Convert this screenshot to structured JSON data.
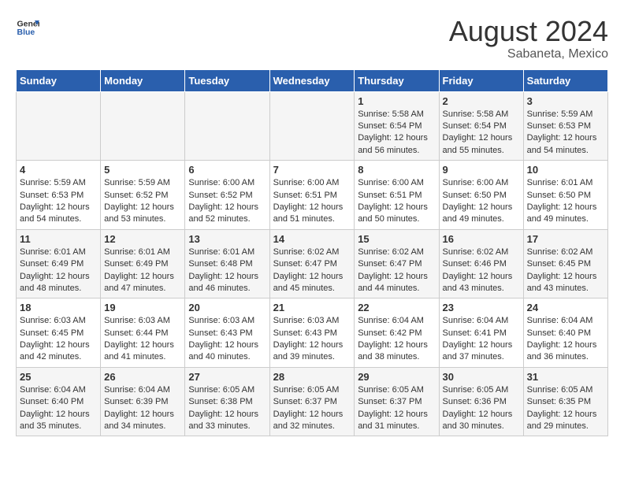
{
  "header": {
    "logo_general": "General",
    "logo_blue": "Blue",
    "title": "August 2024",
    "subtitle": "Sabaneta, Mexico"
  },
  "calendar": {
    "days_of_week": [
      "Sunday",
      "Monday",
      "Tuesday",
      "Wednesday",
      "Thursday",
      "Friday",
      "Saturday"
    ],
    "weeks": [
      [
        {
          "day": "",
          "detail": ""
        },
        {
          "day": "",
          "detail": ""
        },
        {
          "day": "",
          "detail": ""
        },
        {
          "day": "",
          "detail": ""
        },
        {
          "day": "1",
          "detail": "Sunrise: 5:58 AM\nSunset: 6:54 PM\nDaylight: 12 hours and 56 minutes."
        },
        {
          "day": "2",
          "detail": "Sunrise: 5:58 AM\nSunset: 6:54 PM\nDaylight: 12 hours and 55 minutes."
        },
        {
          "day": "3",
          "detail": "Sunrise: 5:59 AM\nSunset: 6:53 PM\nDaylight: 12 hours and 54 minutes."
        }
      ],
      [
        {
          "day": "4",
          "detail": "Sunrise: 5:59 AM\nSunset: 6:53 PM\nDaylight: 12 hours and 54 minutes."
        },
        {
          "day": "5",
          "detail": "Sunrise: 5:59 AM\nSunset: 6:52 PM\nDaylight: 12 hours and 53 minutes."
        },
        {
          "day": "6",
          "detail": "Sunrise: 6:00 AM\nSunset: 6:52 PM\nDaylight: 12 hours and 52 minutes."
        },
        {
          "day": "7",
          "detail": "Sunrise: 6:00 AM\nSunset: 6:51 PM\nDaylight: 12 hours and 51 minutes."
        },
        {
          "day": "8",
          "detail": "Sunrise: 6:00 AM\nSunset: 6:51 PM\nDaylight: 12 hours and 50 minutes."
        },
        {
          "day": "9",
          "detail": "Sunrise: 6:00 AM\nSunset: 6:50 PM\nDaylight: 12 hours and 49 minutes."
        },
        {
          "day": "10",
          "detail": "Sunrise: 6:01 AM\nSunset: 6:50 PM\nDaylight: 12 hours and 49 minutes."
        }
      ],
      [
        {
          "day": "11",
          "detail": "Sunrise: 6:01 AM\nSunset: 6:49 PM\nDaylight: 12 hours and 48 minutes."
        },
        {
          "day": "12",
          "detail": "Sunrise: 6:01 AM\nSunset: 6:49 PM\nDaylight: 12 hours and 47 minutes."
        },
        {
          "day": "13",
          "detail": "Sunrise: 6:01 AM\nSunset: 6:48 PM\nDaylight: 12 hours and 46 minutes."
        },
        {
          "day": "14",
          "detail": "Sunrise: 6:02 AM\nSunset: 6:47 PM\nDaylight: 12 hours and 45 minutes."
        },
        {
          "day": "15",
          "detail": "Sunrise: 6:02 AM\nSunset: 6:47 PM\nDaylight: 12 hours and 44 minutes."
        },
        {
          "day": "16",
          "detail": "Sunrise: 6:02 AM\nSunset: 6:46 PM\nDaylight: 12 hours and 43 minutes."
        },
        {
          "day": "17",
          "detail": "Sunrise: 6:02 AM\nSunset: 6:45 PM\nDaylight: 12 hours and 43 minutes."
        }
      ],
      [
        {
          "day": "18",
          "detail": "Sunrise: 6:03 AM\nSunset: 6:45 PM\nDaylight: 12 hours and 42 minutes."
        },
        {
          "day": "19",
          "detail": "Sunrise: 6:03 AM\nSunset: 6:44 PM\nDaylight: 12 hours and 41 minutes."
        },
        {
          "day": "20",
          "detail": "Sunrise: 6:03 AM\nSunset: 6:43 PM\nDaylight: 12 hours and 40 minutes."
        },
        {
          "day": "21",
          "detail": "Sunrise: 6:03 AM\nSunset: 6:43 PM\nDaylight: 12 hours and 39 minutes."
        },
        {
          "day": "22",
          "detail": "Sunrise: 6:04 AM\nSunset: 6:42 PM\nDaylight: 12 hours and 38 minutes."
        },
        {
          "day": "23",
          "detail": "Sunrise: 6:04 AM\nSunset: 6:41 PM\nDaylight: 12 hours and 37 minutes."
        },
        {
          "day": "24",
          "detail": "Sunrise: 6:04 AM\nSunset: 6:40 PM\nDaylight: 12 hours and 36 minutes."
        }
      ],
      [
        {
          "day": "25",
          "detail": "Sunrise: 6:04 AM\nSunset: 6:40 PM\nDaylight: 12 hours and 35 minutes."
        },
        {
          "day": "26",
          "detail": "Sunrise: 6:04 AM\nSunset: 6:39 PM\nDaylight: 12 hours and 34 minutes."
        },
        {
          "day": "27",
          "detail": "Sunrise: 6:05 AM\nSunset: 6:38 PM\nDaylight: 12 hours and 33 minutes."
        },
        {
          "day": "28",
          "detail": "Sunrise: 6:05 AM\nSunset: 6:37 PM\nDaylight: 12 hours and 32 minutes."
        },
        {
          "day": "29",
          "detail": "Sunrise: 6:05 AM\nSunset: 6:37 PM\nDaylight: 12 hours and 31 minutes."
        },
        {
          "day": "30",
          "detail": "Sunrise: 6:05 AM\nSunset: 6:36 PM\nDaylight: 12 hours and 30 minutes."
        },
        {
          "day": "31",
          "detail": "Sunrise: 6:05 AM\nSunset: 6:35 PM\nDaylight: 12 hours and 29 minutes."
        }
      ]
    ]
  }
}
